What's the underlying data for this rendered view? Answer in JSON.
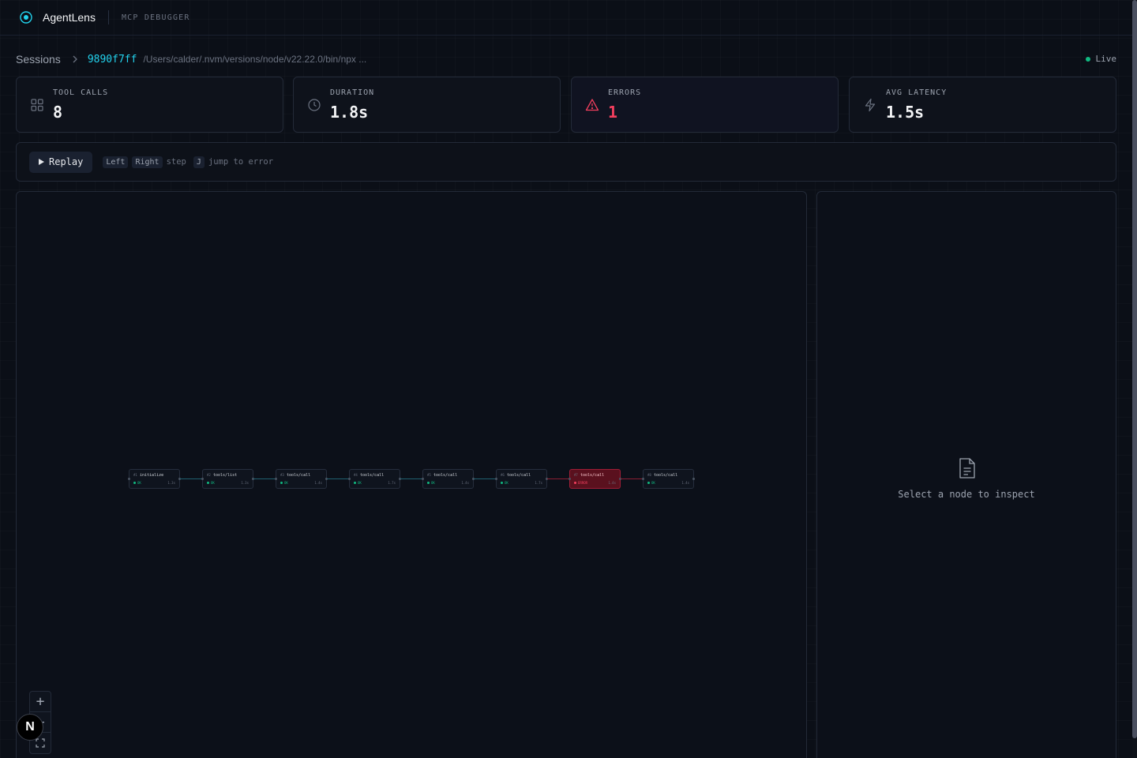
{
  "header": {
    "brand": "AgentLens",
    "subtitle": "MCP DEBUGGER",
    "logo_icon": "radar-target-icon",
    "accent": "#22d3ee"
  },
  "breadcrumb": {
    "root": "Sessions",
    "session_id": "9890f7ff",
    "command_path": "/Users/calder/.nvm/versions/node/v22.22.0/bin/npx ..."
  },
  "status": {
    "label": "Live",
    "color": "#10b981"
  },
  "stats": [
    {
      "label": "TOOL CALLS",
      "value": "8",
      "icon": "grid-icon"
    },
    {
      "label": "DURATION",
      "value": "1.8s",
      "icon": "clock-icon"
    },
    {
      "label": "ERRORS",
      "value": "1",
      "icon": "warning-triangle-icon",
      "color": "#f43f5e"
    },
    {
      "label": "AVG LATENCY",
      "value": "1.5s",
      "icon": "lightning-icon"
    }
  ],
  "replay": {
    "button_label": "Replay",
    "key_left": "Left",
    "key_right": "Right",
    "step_text": "step",
    "key_jump": "J",
    "jump_text": "jump to error"
  },
  "graph": {
    "nodes": [
      {
        "index": "#1",
        "name": "initialize",
        "status": "OK",
        "duration": "1.3s",
        "error": false
      },
      {
        "index": "#2",
        "name": "tools/list",
        "status": "OK",
        "duration": "1.3s",
        "error": false
      },
      {
        "index": "#3",
        "name": "tools/call",
        "status": "OK",
        "duration": "1.4s",
        "error": false
      },
      {
        "index": "#4",
        "name": "tools/call",
        "status": "OK",
        "duration": "1.7s",
        "error": false
      },
      {
        "index": "#5",
        "name": "tools/call",
        "status": "OK",
        "duration": "1.4s",
        "error": false
      },
      {
        "index": "#6",
        "name": "tools/call",
        "status": "OK",
        "duration": "1.7s",
        "error": false
      },
      {
        "index": "#7",
        "name": "tools/call",
        "status": "ERROR",
        "duration": "1.4s",
        "error": true
      },
      {
        "index": "#8",
        "name": "tools/call",
        "status": "OK",
        "duration": "1.4s",
        "error": false
      }
    ]
  },
  "inspector": {
    "empty_text": "Select a node to inspect",
    "icon": "document-icon"
  },
  "controls": {
    "zoom_in": "+",
    "badge": "N"
  }
}
